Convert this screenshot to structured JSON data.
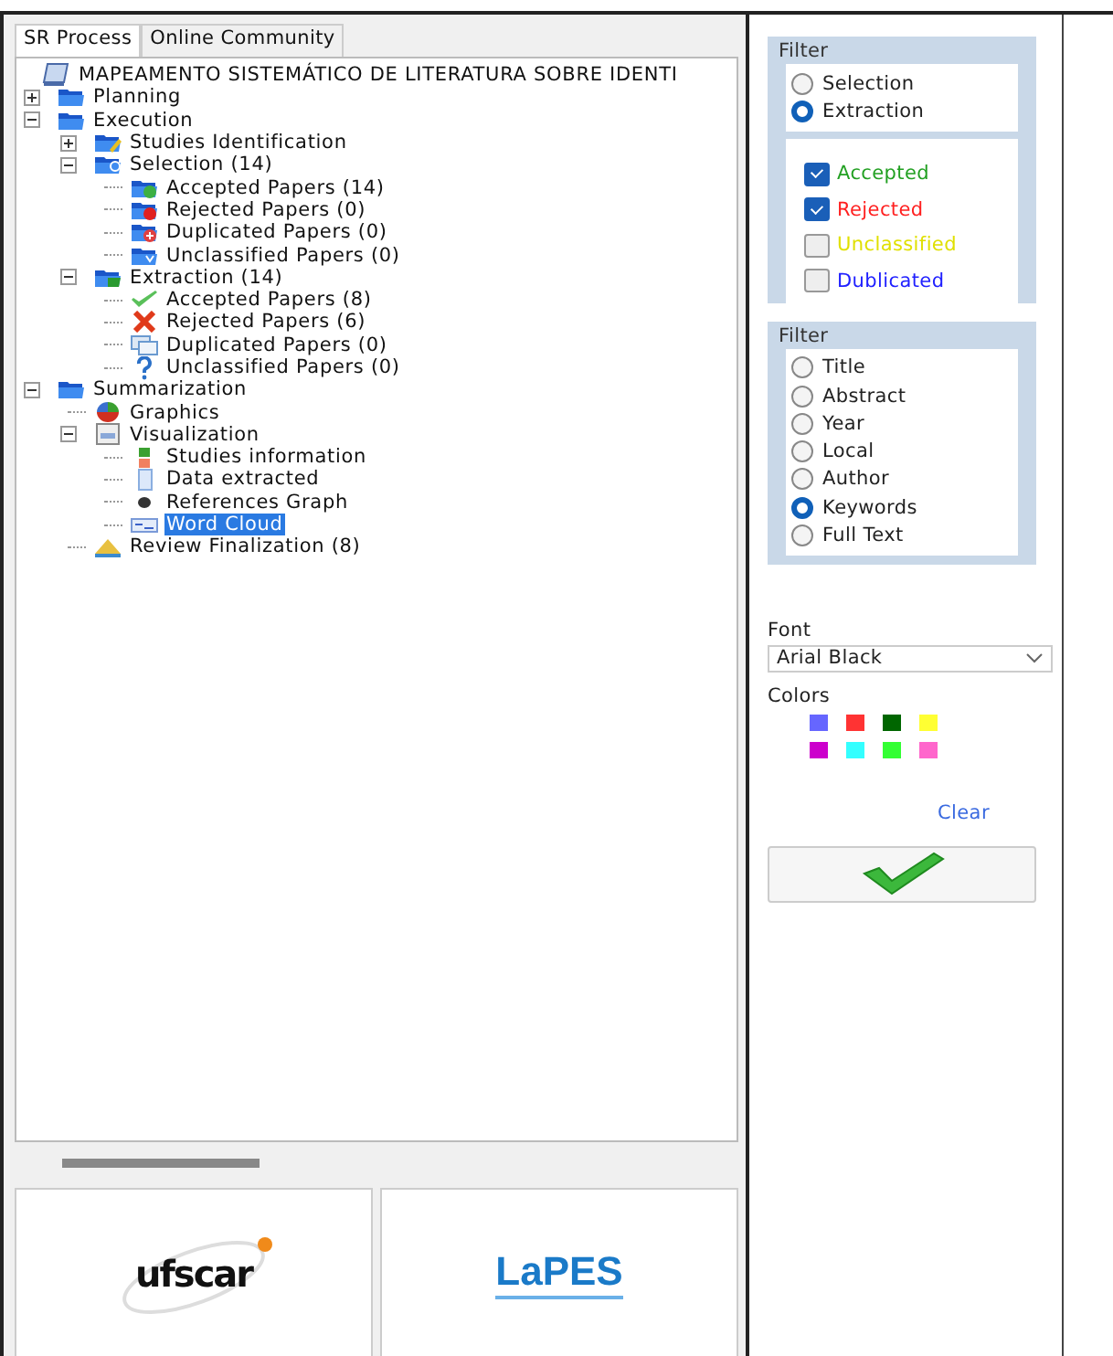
{
  "tabs": [
    {
      "label": "SR Process",
      "selected": true
    },
    {
      "label": "Online Community",
      "selected": false
    }
  ],
  "tree": {
    "label": "MAPEAMENTO SISTEMÁTICO DE LITERATURA SOBRE IDENTI",
    "kind": "book",
    "selected": false,
    "children": [
      {
        "label": "Planning",
        "kind": "folder",
        "expanded": false,
        "selected": false
      },
      {
        "label": "Execution",
        "kind": "folder",
        "expanded": true,
        "selected": false,
        "children": [
          {
            "label": "Studies Identification",
            "kind": "pencil",
            "expanded": false,
            "selected": false
          },
          {
            "label": "Selection (14)",
            "kind": "search",
            "expanded": true,
            "selected": false,
            "children": [
              {
                "label": "Accepted Papers (14)",
                "kind": "accepted",
                "selected": false
              },
              {
                "label": "Rejected Papers (0)",
                "kind": "rejected",
                "selected": false
              },
              {
                "label": "Duplicated Papers (0)",
                "kind": "duplicated",
                "selected": false
              },
              {
                "label": "Unclassified Papers (0)",
                "kind": "unclassified",
                "selected": false
              }
            ]
          },
          {
            "label": "Extraction (14)",
            "kind": "extraction",
            "expanded": true,
            "selected": false,
            "children": [
              {
                "label": "Accepted Papers (8)",
                "kind": "check",
                "selected": false
              },
              {
                "label": "Rejected Papers (6)",
                "kind": "cross",
                "selected": false
              },
              {
                "label": "Duplicated Papers (0)",
                "kind": "windows",
                "selected": false
              },
              {
                "label": "Unclassified Papers (0)",
                "kind": "question",
                "selected": false
              }
            ]
          }
        ]
      },
      {
        "label": "Summarization",
        "kind": "folder",
        "expanded": true,
        "selected": false,
        "children": [
          {
            "label": "Graphics",
            "kind": "pie",
            "selected": false
          },
          {
            "label": "Visualization",
            "kind": "window",
            "expanded": true,
            "selected": false,
            "children": [
              {
                "label": "Studies information",
                "kind": "tiles",
                "selected": false
              },
              {
                "label": "Data extracted",
                "kind": "list",
                "selected": false
              },
              {
                "label": "References Graph",
                "kind": "dot",
                "selected": false
              },
              {
                "label": "Word Cloud",
                "kind": "cloud",
                "selected": true
              }
            ]
          },
          {
            "label": "Review Finalization (8)",
            "kind": "review",
            "selected": false
          }
        ]
      }
    ]
  },
  "logos": [
    {
      "text": "ufscar",
      "kind": "ufscar"
    },
    {
      "text": "LaPES",
      "kind": "lapes"
    }
  ],
  "filter_1": {
    "title": "Filter",
    "phases": [
      {
        "label": "Selection",
        "selected": false
      },
      {
        "label": "Extraction",
        "selected": true
      }
    ],
    "statuses": [
      {
        "label": "Accepted",
        "checked": true,
        "color": "#22a022"
      },
      {
        "label": "Rejected",
        "checked": true,
        "color": "#ff2020"
      },
      {
        "label": "Unclassified",
        "checked": false,
        "color": "#e0e000"
      },
      {
        "label": "Dublicated",
        "checked": false,
        "color": "#2020ff"
      }
    ]
  },
  "filter_2": {
    "title": "Filter",
    "options": [
      {
        "label": "Title",
        "selected": false
      },
      {
        "label": "Abstract",
        "selected": false
      },
      {
        "label": "Year",
        "selected": false
      },
      {
        "label": "Local",
        "selected": false
      },
      {
        "label": "Author",
        "selected": false
      },
      {
        "label": "Keywords",
        "selected": true
      },
      {
        "label": "Full Text",
        "selected": false
      }
    ]
  },
  "font": {
    "label": "Font",
    "value": "Arial Black"
  },
  "colors": {
    "label": "Colors",
    "swatches": [
      {
        "color": "#6666ff"
      },
      {
        "color": "#ff3333"
      },
      {
        "color": "#006600"
      },
      {
        "color": "#ffff33"
      },
      {
        "color": "#cc00cc"
      },
      {
        "color": "#33ffff"
      },
      {
        "color": "#33ff33"
      },
      {
        "color": "#ff66cc"
      }
    ]
  },
  "clear_link": "Clear"
}
